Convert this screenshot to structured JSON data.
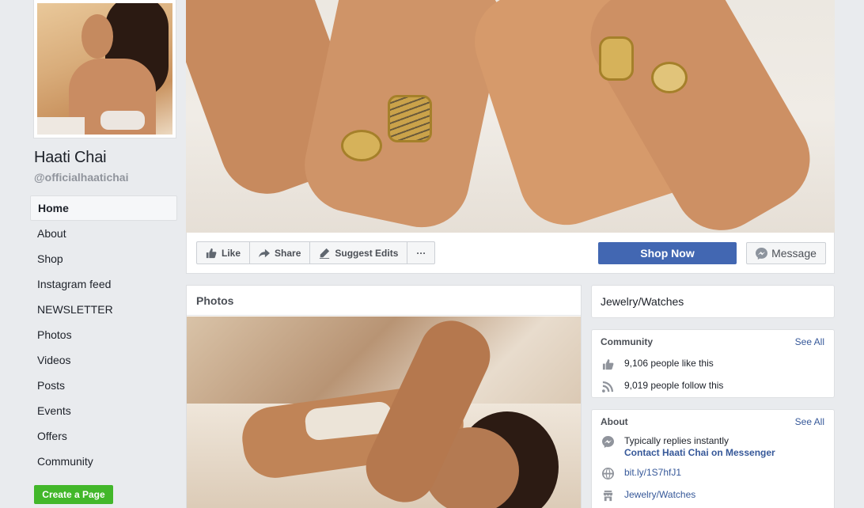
{
  "page": {
    "name": "Haati Chai",
    "handle": "@officialhaatichai"
  },
  "sidebar": {
    "items": [
      {
        "label": "Home",
        "active": true
      },
      {
        "label": "About"
      },
      {
        "label": "Shop"
      },
      {
        "label": "Instagram feed"
      },
      {
        "label": "NEWSLETTER"
      },
      {
        "label": "Photos"
      },
      {
        "label": "Videos"
      },
      {
        "label": "Posts"
      },
      {
        "label": "Events"
      },
      {
        "label": "Offers"
      },
      {
        "label": "Community"
      }
    ],
    "create_page": "Create a Page"
  },
  "actions": {
    "like": "Like",
    "share": "Share",
    "suggest_edits": "Suggest Edits",
    "more": "···",
    "shop_now": "Shop Now",
    "message": "Message"
  },
  "photos": {
    "title": "Photos"
  },
  "right": {
    "category": "Jewelry/Watches",
    "community": {
      "title": "Community",
      "see_all": "See All",
      "likes": "9,106 people like this",
      "follows": "9,019 people follow this"
    },
    "about": {
      "title": "About",
      "see_all": "See All",
      "replies": "Typically replies instantly",
      "contact": "Contact Haati Chai on Messenger",
      "website": "bit.ly/1S7hfJ1",
      "category_link": "Jewelry/Watches"
    }
  },
  "colors": {
    "primary_button": "#4267b2",
    "create_page_green": "#42b72a",
    "link_blue": "#365899",
    "background": "#e9ebee"
  }
}
